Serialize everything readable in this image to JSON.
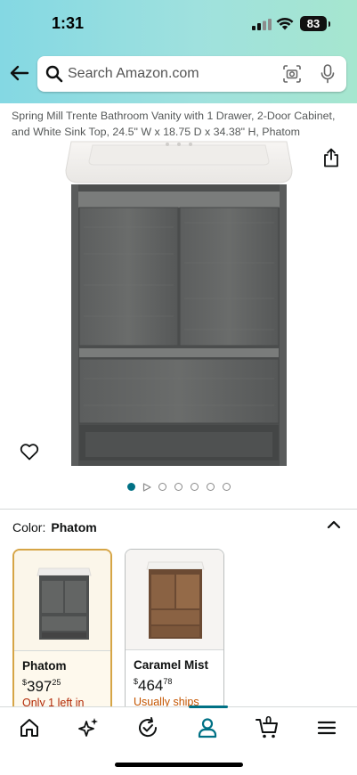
{
  "status_bar": {
    "time": "1:31",
    "battery": "83"
  },
  "search": {
    "placeholder": "Search Amazon.com"
  },
  "product": {
    "title": "Spring Mill Trente Bathroom Vanity with 1 Drawer, 2-Door Cabinet, and White Sink Top, 24.5\" W x 18.75 D x 34.38\" H, Phatom",
    "image_count": 6,
    "active_image": 1
  },
  "color": {
    "label": "Color:",
    "selected": "Phatom"
  },
  "variants": [
    {
      "name": "Phatom",
      "price_symbol": "$",
      "price_dollars": "397",
      "price_cents": "25",
      "availability": "Only 1 left in",
      "availability_color": "#b12704",
      "selected": true
    },
    {
      "name": "Caramel Mist",
      "price_symbol": "$",
      "price_dollars": "464",
      "price_cents": "78",
      "availability": "Usually ships",
      "availability_color": "#c45500",
      "selected": false
    }
  ],
  "tabbar": {
    "items": [
      "home-icon",
      "sparkle-icon",
      "orders-icon",
      "account-icon",
      "cart-icon",
      "menu-icon"
    ],
    "active": "account-icon",
    "cart_count": "0",
    "accent": "#007185"
  },
  "colors": {
    "accent": "#007185",
    "selected_border": "#d6a546"
  }
}
